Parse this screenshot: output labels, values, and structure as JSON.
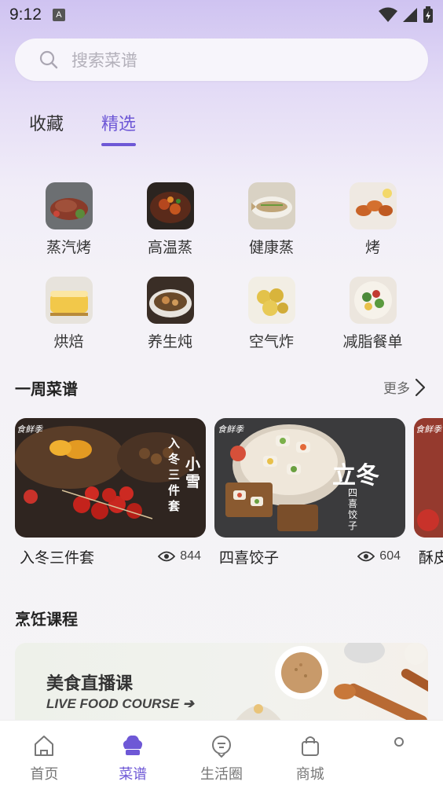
{
  "status_bar": {
    "time": "9:12",
    "notification_letter": "A"
  },
  "search": {
    "placeholder": "搜索菜谱"
  },
  "tabs": [
    {
      "label": "收藏",
      "active": false
    },
    {
      "label": "精选",
      "active": true
    }
  ],
  "categories": [
    {
      "label": "蒸汽烤",
      "icon": "steak-photo"
    },
    {
      "label": "高温蒸",
      "icon": "braised-dish-photo"
    },
    {
      "label": "健康蒸",
      "icon": "steamed-fish-photo"
    },
    {
      "label": "烤",
      "icon": "grilled-wings-photo"
    },
    {
      "label": "烘焙",
      "icon": "cake-photo"
    },
    {
      "label": "养生炖",
      "icon": "stew-photo"
    },
    {
      "label": "空气炸",
      "icon": "fried-potato-photo"
    },
    {
      "label": "减脂餐单",
      "icon": "salad-photo"
    }
  ],
  "weekly": {
    "title": "一周菜谱",
    "more_label": "更多",
    "cards": [
      {
        "title": "入冬三件套",
        "views": "844",
        "image_text": [
          "入冬三件套",
          "小雪"
        ],
        "logo": "食鲜季"
      },
      {
        "title": "四喜饺子",
        "views": "604",
        "image_text": [
          "立冬",
          "四喜饺子"
        ],
        "logo": "食鲜季"
      },
      {
        "title": "酥皮",
        "views": "",
        "logo": "食鲜季"
      }
    ]
  },
  "course": {
    "title": "烹饪课程",
    "banner_title": "美食直播课",
    "banner_sub": "LIVE FOOD COURSE ➔"
  },
  "bottom_nav": [
    {
      "label": "首页",
      "icon": "home-icon",
      "active": false
    },
    {
      "label": "菜谱",
      "icon": "chef-hat-icon",
      "active": true
    },
    {
      "label": "生活圈",
      "icon": "chat-circle-icon",
      "active": false
    },
    {
      "label": "商城",
      "icon": "shopping-bag-icon",
      "active": false
    }
  ],
  "colors": {
    "accent": "#6e58d6"
  }
}
